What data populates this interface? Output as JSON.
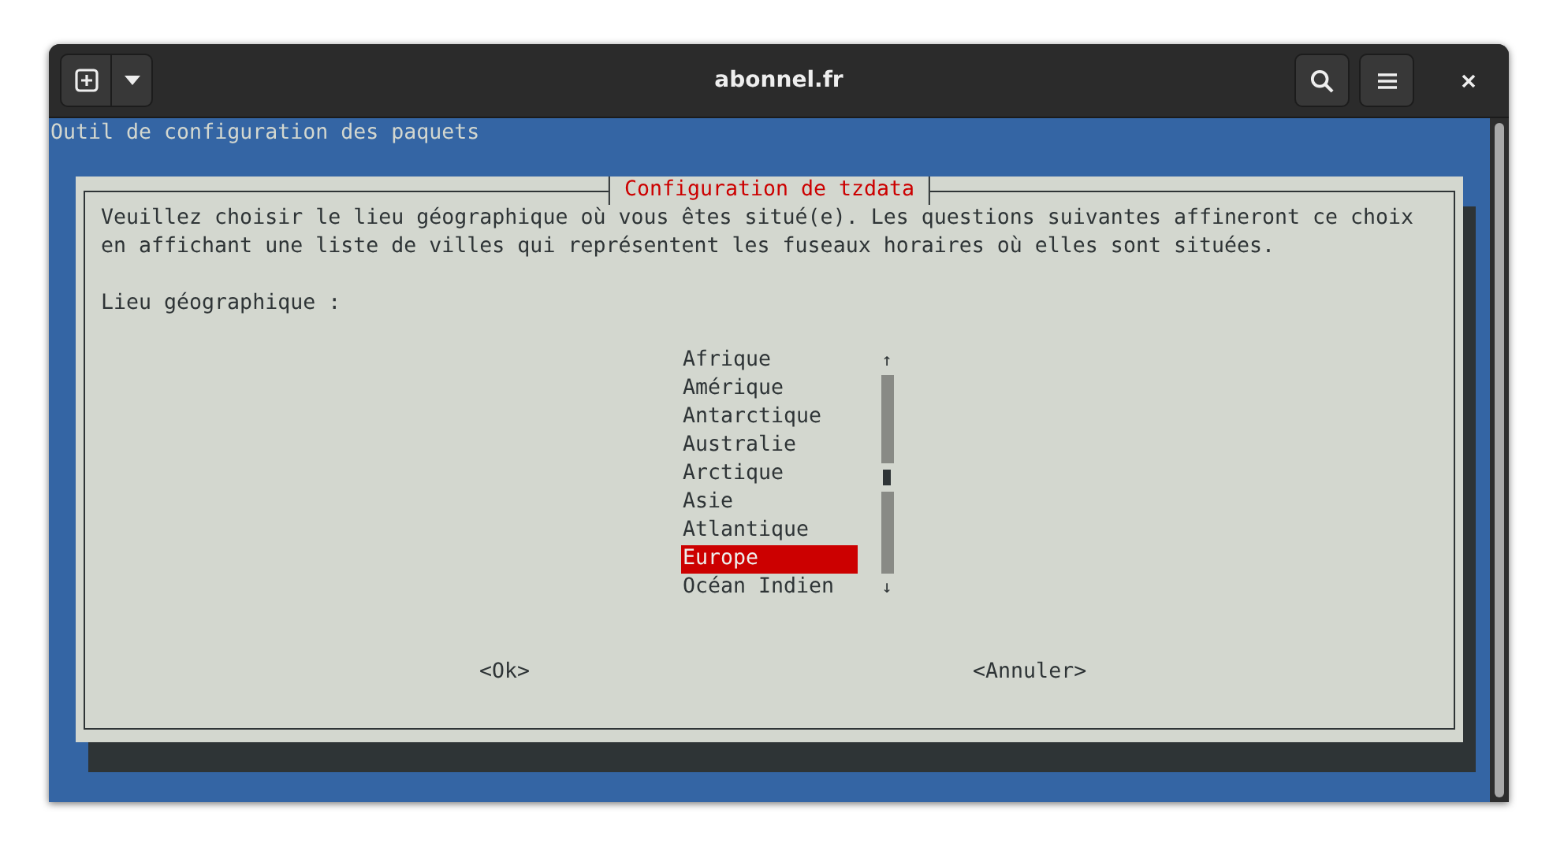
{
  "window": {
    "title": "abonnel.fr"
  },
  "terminal": {
    "backtitle": "Outil de configuration des paquets",
    "dialog": {
      "title": "Configuration de tzdata",
      "message": [
        "Veuillez choisir le lieu géographique où vous êtes situé(e). Les questions suivantes affineront ce choix",
        "en affichant une liste de villes qui représentent les fuseaux horaires où elles sont situées."
      ],
      "label": "Lieu géographique :",
      "items": [
        {
          "label": "Afrique",
          "selected": false
        },
        {
          "label": "Amérique",
          "selected": false
        },
        {
          "label": "Antarctique",
          "selected": false
        },
        {
          "label": "Australie",
          "selected": false
        },
        {
          "label": "Arctique",
          "selected": false
        },
        {
          "label": "Asie",
          "selected": false
        },
        {
          "label": "Atlantique",
          "selected": false
        },
        {
          "label": "Europe",
          "selected": true
        },
        {
          "label": "Océan Indien",
          "selected": false
        }
      ],
      "scroll_up": "↑",
      "scroll_down": "↓",
      "buttons": [
        "<Ok>",
        "<Annuler>"
      ]
    }
  }
}
